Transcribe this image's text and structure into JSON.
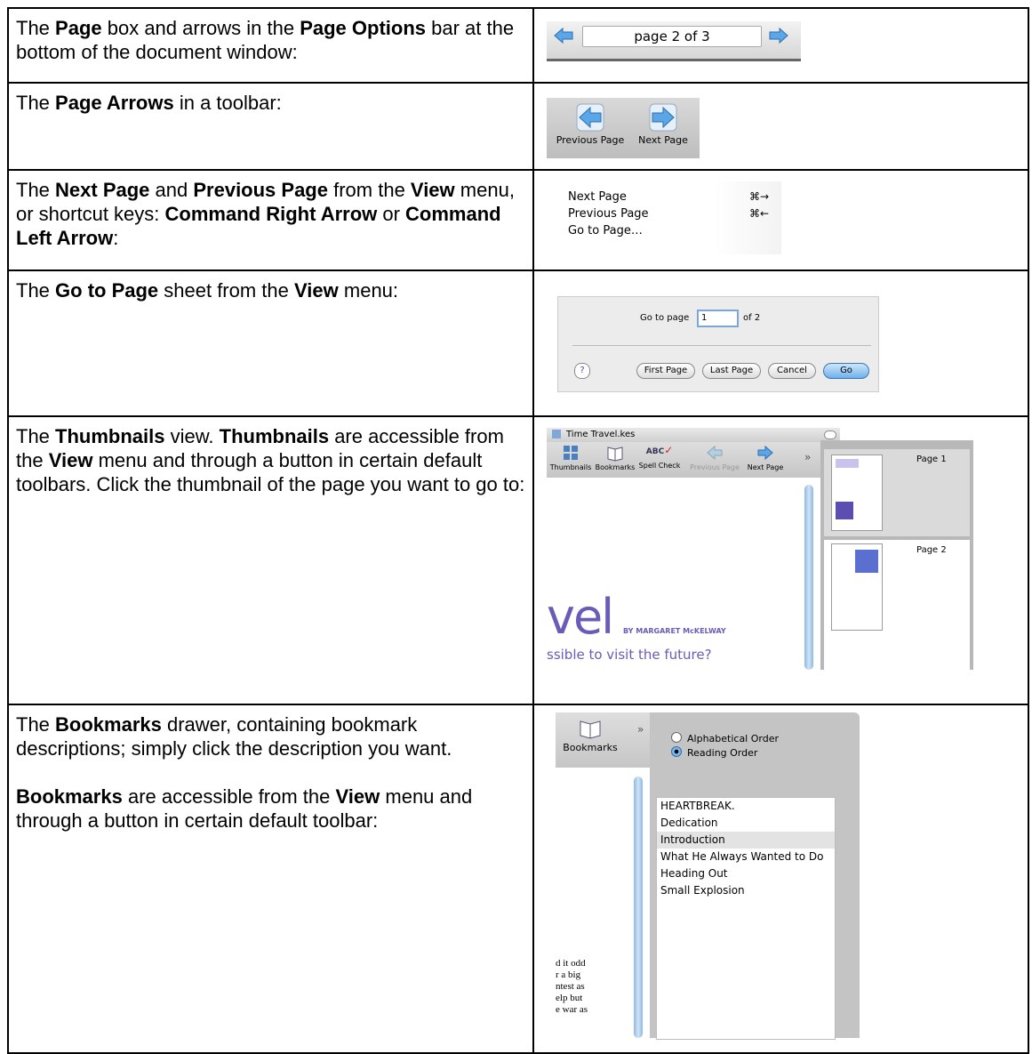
{
  "rows": [
    {
      "desc": [
        "The ",
        "Page",
        " box and arrows in the ",
        "Page Options",
        " bar at the bottom of the document window:"
      ],
      "shot": {
        "page_label": "page 2 of 3"
      }
    },
    {
      "desc": [
        "The ",
        "Page Arrows",
        " in a toolbar:"
      ],
      "shot": {
        "prev_label": "Previous Page",
        "next_label": "Next Page"
      }
    },
    {
      "desc": [
        "The ",
        "Next Page",
        " and ",
        "Previous Page",
        " from the ",
        "View",
        " menu, or shortcut keys: ",
        "Command Right Arrow",
        " or ",
        "Command Left Arrow",
        ":"
      ],
      "shot": {
        "items": [
          {
            "label": "Next Page",
            "shortcut": "⌘→"
          },
          {
            "label": "Previous Page",
            "shortcut": "⌘←"
          },
          {
            "label": "Go to Page…",
            "shortcut": ""
          }
        ]
      }
    },
    {
      "desc": [
        "The ",
        "Go to Page",
        " sheet from the ",
        "View",
        " menu:"
      ],
      "shot": {
        "go_to_label": "Go to page",
        "page_value": "1",
        "of_label": "of 2",
        "help": "?",
        "buttons": [
          "First Page",
          "Last Page",
          "Cancel",
          "Go"
        ]
      }
    },
    {
      "desc": [
        "The ",
        "Thumbnails",
        " view. ",
        "Thumbnails",
        " are accessible from the ",
        "View",
        " menu and through a button in certain default toolbars. Click the thumbnail of the page you want to go to:"
      ],
      "shot": {
        "window_title": "Time Travel.kes",
        "toolbar": [
          "Thumbnails",
          "Bookmarks",
          "Spell Check",
          "Previous Page",
          "Next Page"
        ],
        "more": "»",
        "abc": "ABC",
        "page1": "Page 1",
        "page2": "Page 2",
        "doc_big": "vel",
        "doc_by": "BY MARGARET McKELWAY",
        "doc_line": "ssible to visit the future?"
      }
    },
    {
      "desc1": [
        "The ",
        "Bookmarks",
        " drawer, containing bookmark descriptions; simply click the description you want."
      ],
      "desc2": [
        "Bookmarks",
        " are accessible from the ",
        "View",
        " menu and through a button in certain default toolbar:"
      ],
      "shot": {
        "toolbar_label": "Bookmarks",
        "more": "»",
        "radio_alpha": "Alphabetical Order",
        "radio_reading": "Reading Order",
        "items": [
          "HEARTBREAK.",
          "Dedication",
          "Introduction",
          "What He Always Wanted to Do",
          "Heading Out",
          "Small Explosion"
        ],
        "body_text": [
          "d it odd",
          "r  a  big",
          "ntest as",
          "elp but",
          "e war as"
        ]
      }
    }
  ]
}
